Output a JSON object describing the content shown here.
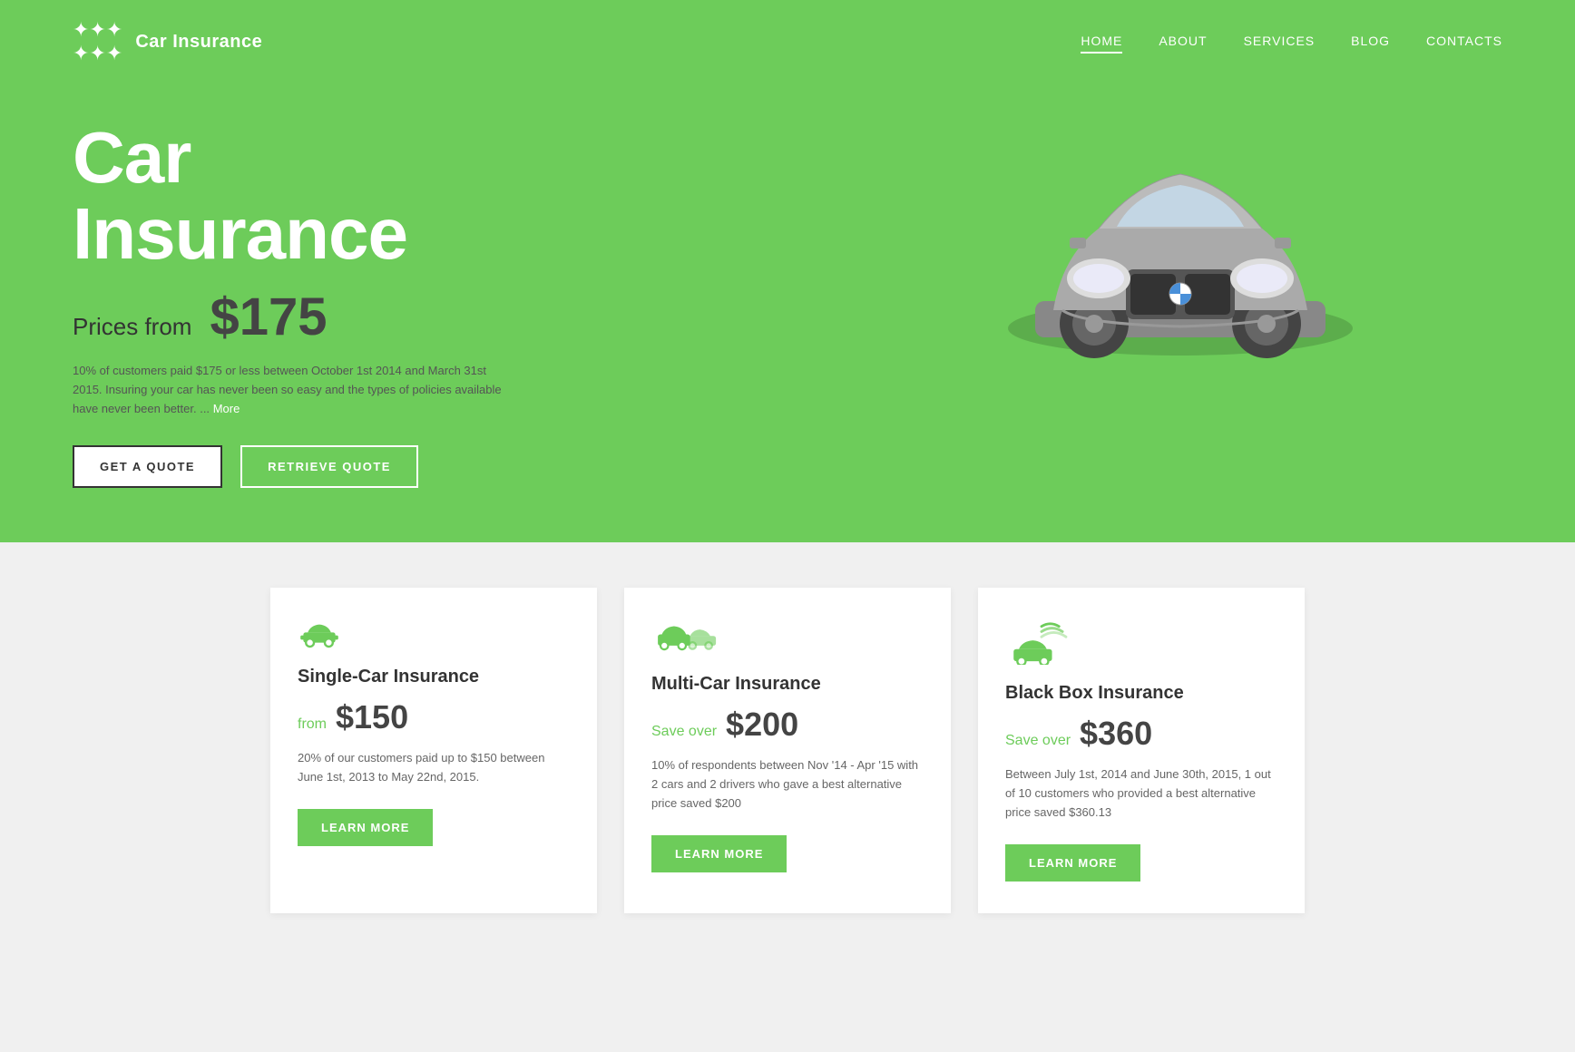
{
  "brand": {
    "logo_symbol": "✦",
    "name": "Car Insurance"
  },
  "nav": {
    "items": [
      {
        "label": "HOME",
        "active": true
      },
      {
        "label": "ABOUT",
        "active": false
      },
      {
        "label": "SERVICES",
        "active": false
      },
      {
        "label": "BLOG",
        "active": false
      },
      {
        "label": "CONTACTS",
        "active": false
      }
    ]
  },
  "hero": {
    "title_line1": "Car",
    "title_line2": "Insurance",
    "price_label": "Prices from",
    "price_value": "$175",
    "description": "10% of customers paid $175 or less between October 1st 2014 and March 31st 2015. Insuring your car has never been so easy and the types of policies available have never been better. ...",
    "more_link": "More",
    "btn_quote": "GET A QUOTE",
    "btn_retrieve": "RETRIEVE QUOTE"
  },
  "cards": [
    {
      "id": "single-car",
      "title": "Single-Car Insurance",
      "price_label": "from",
      "price_value": "$150",
      "description": "20% of our customers paid up to $150 between June 1st, 2013 to May 22nd, 2015.",
      "btn_label": "LEARN MORE",
      "icon_type": "single"
    },
    {
      "id": "multi-car",
      "title": "Multi-Car Insurance",
      "price_label": "Save over",
      "price_value": "$200",
      "description": "10% of respondents between Nov '14 - Apr '15 with 2 cars and 2 drivers who gave a best alternative price saved $200",
      "btn_label": "LEARN MORE",
      "icon_type": "multi"
    },
    {
      "id": "black-box",
      "title": "Black Box Insurance",
      "price_label": "Save over",
      "price_value": "$360",
      "description": "Between July 1st, 2014 and June 30th, 2015, 1 out of 10 customers who provided a best alternative price saved $360.13",
      "btn_label": "LEARN MORE",
      "icon_type": "blackbox"
    }
  ],
  "colors": {
    "green": "#6dcc5a",
    "dark_text": "#444",
    "light_text": "#666"
  }
}
